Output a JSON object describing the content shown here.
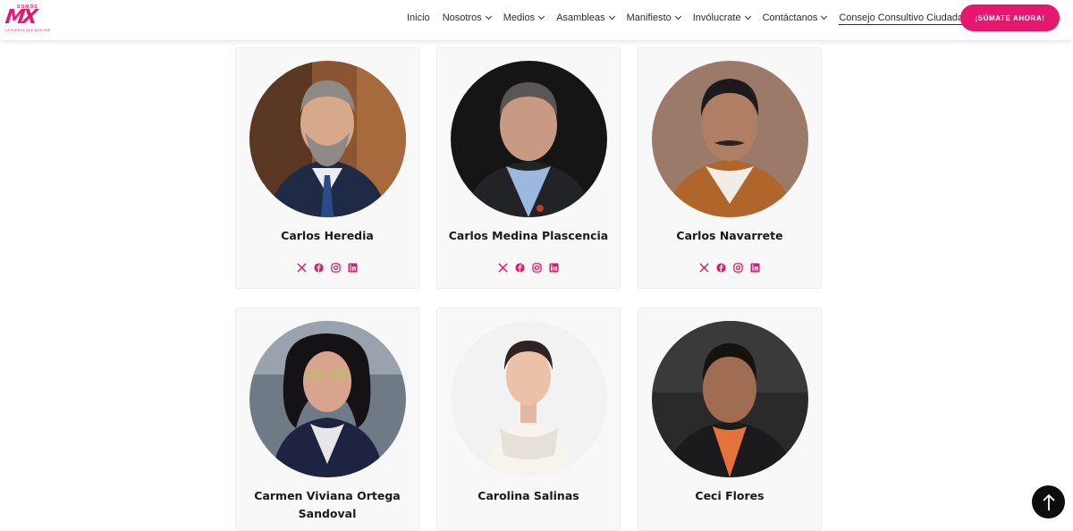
{
  "brand": {
    "logo_top": "SOMOS",
    "logo_main": "MX",
    "logo_tagline": "LA FUERZA QUE NOS UNE",
    "accent_color": "#e6176f"
  },
  "nav": {
    "items": [
      {
        "label": "Inicio",
        "has_dropdown": false
      },
      {
        "label": "Nosotros",
        "has_dropdown": true
      },
      {
        "label": "Medios",
        "has_dropdown": true
      },
      {
        "label": "Asambleas",
        "has_dropdown": true
      },
      {
        "label": "Manifiesto",
        "has_dropdown": true
      },
      {
        "label": "Invólucrate",
        "has_dropdown": true
      },
      {
        "label": "Contáctanos",
        "has_dropdown": true
      },
      {
        "label": "Consejo Consultivo Ciudadano",
        "has_dropdown": true,
        "active": true
      }
    ],
    "cta_label": "¡SÚMATE AHORA!"
  },
  "members": [
    {
      "name": "Carlos Heredia",
      "photo_bg": "#8a5530",
      "socials": [
        "x-icon",
        "facebook-icon",
        "instagram-icon",
        "linkedin-icon"
      ]
    },
    {
      "name": "Carlos Medina Plascencia",
      "photo_bg": "#151515",
      "socials": [
        "x-icon",
        "facebook-icon",
        "instagram-icon",
        "linkedin-icon"
      ]
    },
    {
      "name": "Carlos Navarrete",
      "photo_bg": "#9c7a6a",
      "socials": [
        "x-icon",
        "facebook-icon",
        "instagram-icon",
        "linkedin-icon"
      ]
    },
    {
      "name": "Carmen Viviana Ortega Sandoval",
      "photo_bg": "#6f7a86",
      "socials": []
    },
    {
      "name": "Carolina Salinas",
      "photo_bg": "#f2f2f2",
      "socials": []
    },
    {
      "name": "Ceci Flores",
      "photo_bg": "#2a2a2a",
      "socials": []
    }
  ],
  "scroll_top_icon": "arrow-up-icon"
}
